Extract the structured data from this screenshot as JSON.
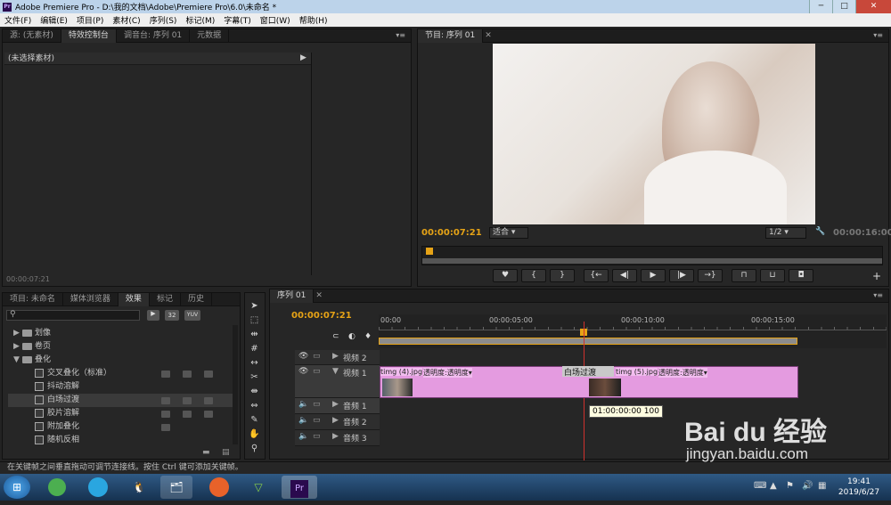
{
  "window": {
    "title": "Adobe Premiere Pro - D:\\我的文档\\Adobe\\Premiere Pro\\6.0\\未命名 *",
    "min": "─",
    "max": "□",
    "close": "✕"
  },
  "menu": [
    "文件(F)",
    "编辑(E)",
    "项目(P)",
    "素材(C)",
    "序列(S)",
    "标记(M)",
    "字幕(T)",
    "窗口(W)",
    "帮助(H)"
  ],
  "source_panel": {
    "tabs": [
      "源: (无素材)",
      "特效控制台",
      "调音台: 序列 01",
      "元数据"
    ],
    "no_clip": "(未选择素材)",
    "timecode": "00:00:07:21"
  },
  "program_panel": {
    "tab": "节目: 序列 01",
    "timecode": "00:00:07:21",
    "fit": "适合",
    "ratio": "1/2",
    "duration": "00:00:16:00"
  },
  "project_panel": {
    "tabs": [
      "项目: 未命名",
      "媒体浏览器",
      "效果",
      "标记",
      "历史"
    ],
    "search_placeholder": "",
    "badges": [
      "32",
      "YUV"
    ],
    "tree": [
      {
        "label": "划像",
        "level": 1,
        "type": "folder",
        "tri": "▶"
      },
      {
        "label": "卷页",
        "level": 1,
        "type": "folder",
        "tri": "▶"
      },
      {
        "label": "叠化",
        "level": 1,
        "type": "folder",
        "tri": "▼"
      },
      {
        "label": "交叉叠化（标准）",
        "level": 2,
        "type": "fx",
        "badges": 3
      },
      {
        "label": "抖动溶解",
        "level": 2,
        "type": "fx",
        "badges": 0
      },
      {
        "label": "白场过渡",
        "level": 2,
        "type": "fx",
        "badges": 3
      },
      {
        "label": "胶片溶解",
        "level": 2,
        "type": "fx",
        "badges": 3
      },
      {
        "label": "附加叠化",
        "level": 2,
        "type": "fx",
        "badges": 1
      },
      {
        "label": "随机反相",
        "level": 2,
        "type": "fx",
        "badges": 0
      }
    ]
  },
  "timeline": {
    "tab": "序列 01",
    "timecode": "00:00:07:21",
    "ruler": [
      "00:00",
      "00:00:05:00",
      "00:00:10:00",
      "00:00:15:00"
    ],
    "tracks": [
      {
        "name": "视频 2"
      },
      {
        "name": "视频 1"
      },
      {
        "name": "音频 1"
      },
      {
        "name": "音频 2"
      },
      {
        "name": "音频 3"
      }
    ],
    "clips": [
      {
        "label": "timg (4).jpg",
        "opacity": "透明度:透明度▾"
      },
      {
        "label": "timg (5).jpg",
        "opacity": "透明度:透明度▾"
      }
    ],
    "transition": "白场过渡",
    "tooltip": "01:00:00:00  100"
  },
  "status": "在关键帧之间垂直拖动可调节连接线。按住 Ctrl 键可添加关键帧。",
  "clock": {
    "time": "19:41",
    "date": "2019/6/27"
  },
  "watermark": {
    "brand": "Bai du 经验",
    "url": "jingyan.baidu.com"
  }
}
